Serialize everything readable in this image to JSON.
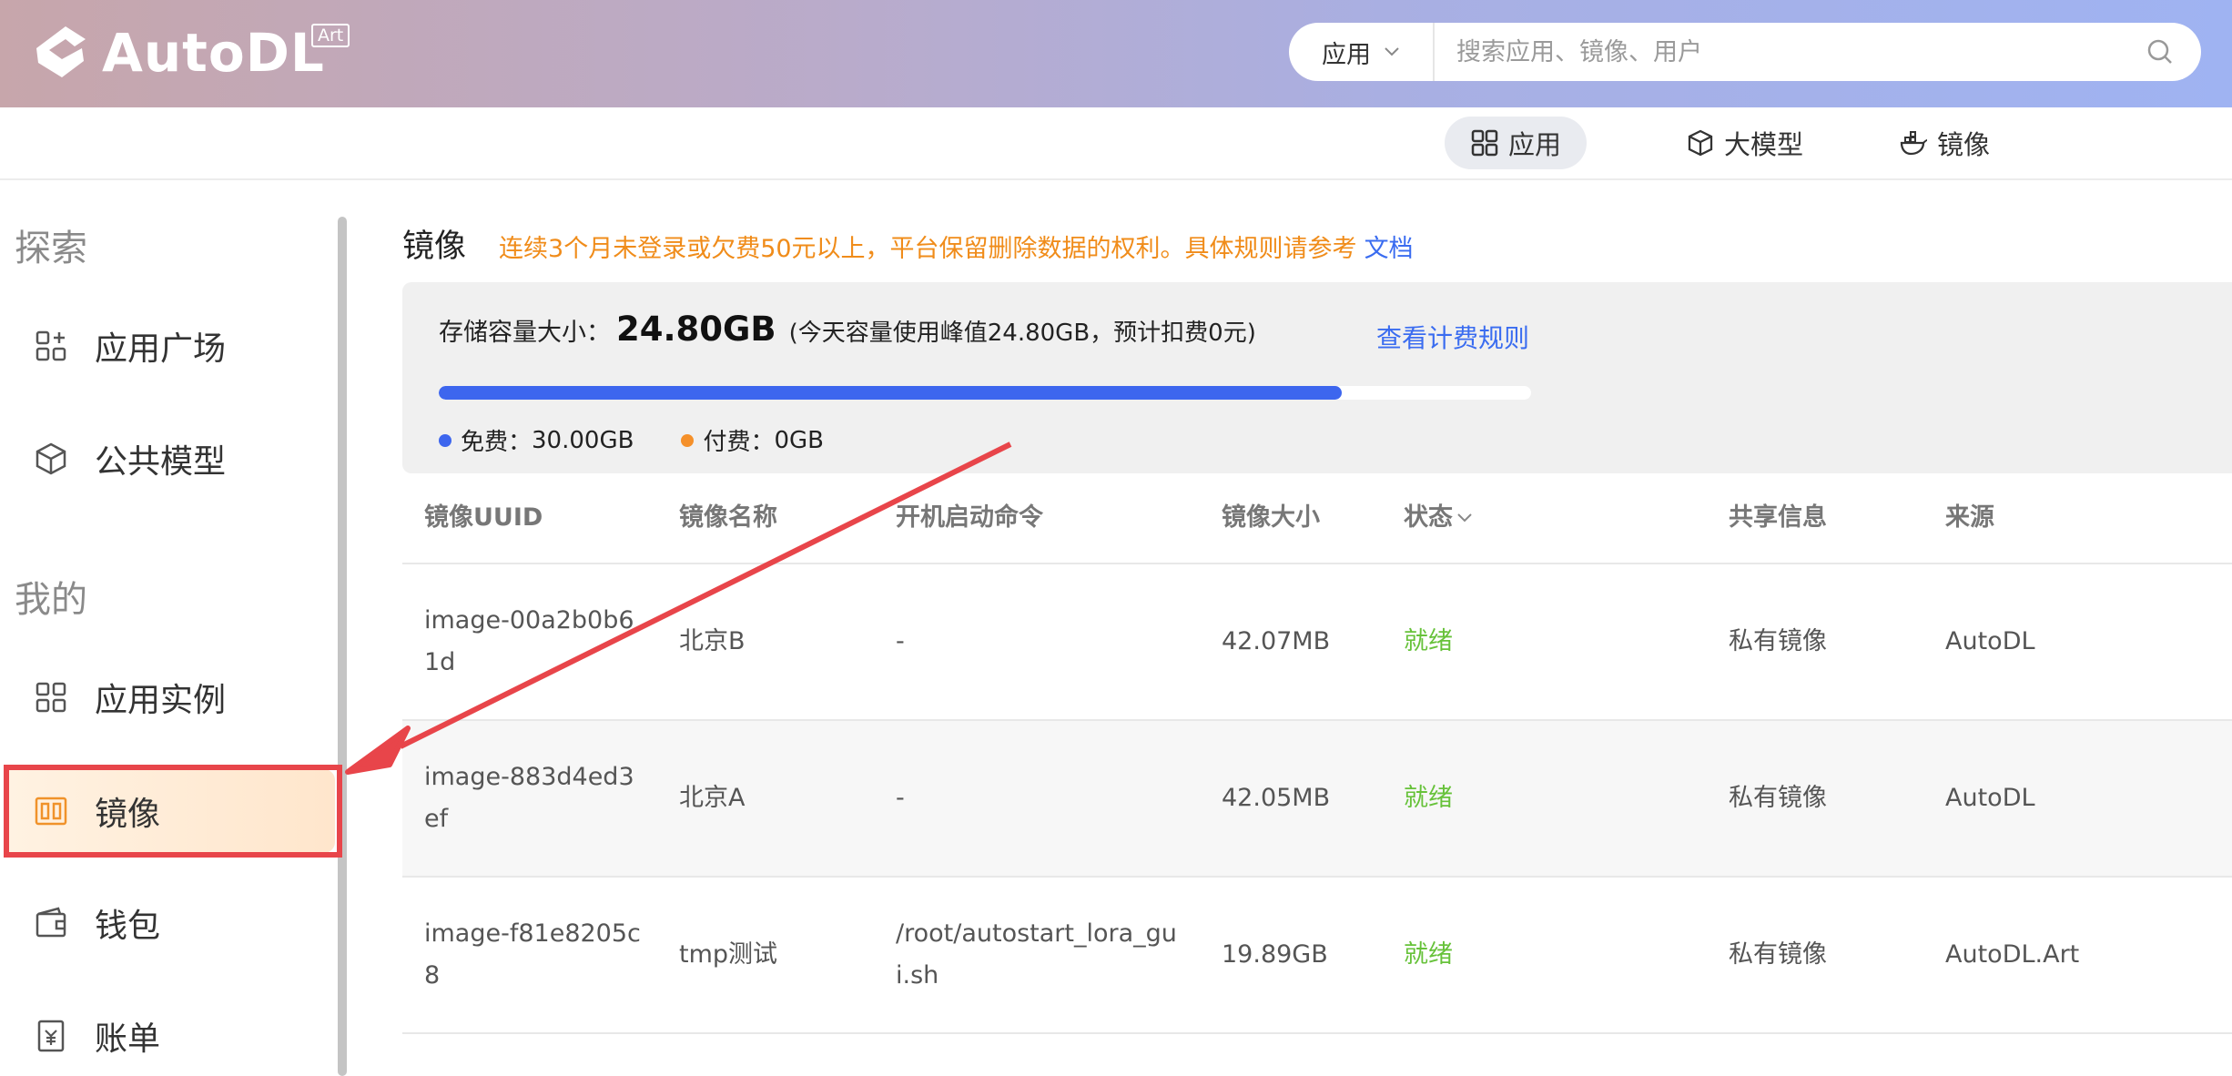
{
  "header": {
    "logo_text": "AutoDL",
    "logo_badge": "Art",
    "search": {
      "type_selected": "应用",
      "placeholder": "搜索应用、镜像、用户"
    }
  },
  "subnav": {
    "tabs": [
      {
        "label": "应用",
        "icon": "grid-icon",
        "active": true
      },
      {
        "label": "大模型",
        "icon": "cube-icon",
        "active": false
      },
      {
        "label": "镜像",
        "icon": "docker-icon",
        "active": false
      }
    ]
  },
  "sidebar": {
    "explore_title": "探索",
    "mine_title": "我的",
    "items": [
      {
        "label": "应用广场",
        "icon": "apps-plus-icon"
      },
      {
        "label": "公共模型",
        "icon": "cube-icon"
      },
      {
        "label": "应用实例",
        "icon": "instances-icon"
      },
      {
        "label": "镜像",
        "icon": "image-icon",
        "active": true
      },
      {
        "label": "钱包",
        "icon": "wallet-icon"
      },
      {
        "label": "账单",
        "icon": "bill-icon"
      }
    ]
  },
  "main": {
    "title": "镜像",
    "notice": "连续3个月未登录或欠费50元以上，平台保留删除数据的权利。具体规则请参考",
    "notice_link": "文档",
    "storage": {
      "label": "存储容量大小：",
      "value": "24.80GB",
      "note": "(今天容量使用峰值24.80GB，预计扣费0元)",
      "rule_link": "查看计费规则",
      "usage_fraction": 0.827,
      "free_label": "免费：",
      "free_value": "30.00GB",
      "paid_label": "付费：",
      "paid_value": "0GB",
      "colors": {
        "free": "#3d66ee",
        "paid": "#f5902a"
      }
    },
    "table": {
      "headers": [
        "镜像UUID",
        "镜像名称",
        "开机启动命令",
        "镜像大小",
        "状态",
        "共享信息",
        "来源"
      ],
      "rows": [
        {
          "uuid": "image-00a2b0b61d",
          "name": "北京B",
          "cmd": "-",
          "size": "42.07MB",
          "status": "就绪",
          "share": "私有镜像",
          "source": "AutoDL"
        },
        {
          "uuid": "image-883d4ed3ef",
          "name": "北京A",
          "cmd": "-",
          "size": "42.05MB",
          "status": "就绪",
          "share": "私有镜像",
          "source": "AutoDL"
        },
        {
          "uuid": "image-f81e8205c8",
          "name": "tmp测试",
          "cmd": "/root/autostart_lora_gui.sh",
          "size": "19.89GB",
          "status": "就绪",
          "share": "私有镜像",
          "source": "AutoDL.Art"
        }
      ]
    }
  }
}
